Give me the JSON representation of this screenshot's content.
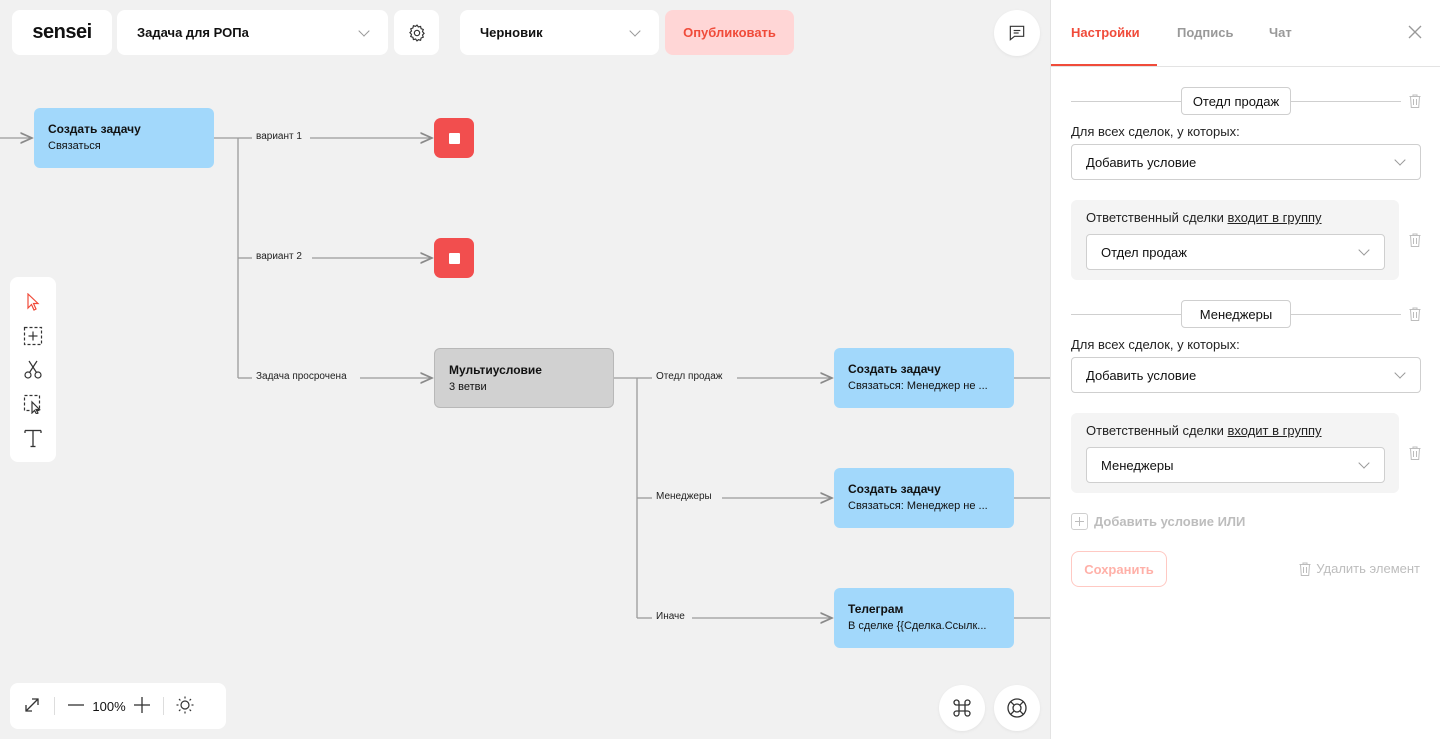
{
  "header": {
    "logo": "sensei",
    "process_name": "Задача для РОПа",
    "status": "Черновик",
    "publish_label": "Опубликовать"
  },
  "canvas": {
    "nodes": {
      "create_task_1": {
        "title": "Создать задачу",
        "subtitle": "Связаться"
      },
      "multi": {
        "title": "Мультиусловие",
        "subtitle": "3 ветви"
      },
      "create_task_2": {
        "title": "Создать задачу",
        "subtitle": "Связаться: Менеджер не ..."
      },
      "create_task_3": {
        "title": "Создать задачу",
        "subtitle": "Связаться: Менеджер не ..."
      },
      "telegram": {
        "title": "Телеграм",
        "subtitle": "В сделке {{Сделка.Ссылк..."
      }
    },
    "edge_labels": {
      "v1": "вариант 1",
      "v2": "вариант 2",
      "overdue": "Задача просрочена",
      "sales": "Отедл продаж",
      "managers": "Менеджеры",
      "else": "Иначе"
    },
    "zoom": "100%"
  },
  "panel": {
    "tabs": [
      "Настройки",
      "Подпись",
      "Чат"
    ],
    "groups": [
      {
        "name": "Отедл продаж",
        "for_all_label": "Для всех сделок, у которых:",
        "add_condition": "Добавить условие",
        "cond_prefix": "Ответственный сделки",
        "cond_link": "входит в группу",
        "cond_value": "Отдел продаж"
      },
      {
        "name": "Менеджеры",
        "for_all_label": "Для всех сделок, у которых:",
        "add_condition": "Добавить условие",
        "cond_prefix": "Ответственный сделки",
        "cond_link": "входит в группу",
        "cond_value": "Менеджеры"
      }
    ],
    "add_or": "Добавить условие ИЛИ",
    "save": "Сохранить",
    "delete_element": "Удалить элемент"
  },
  "colors": {
    "accent": "#f04b3a",
    "node_blue": "#a2d8fb",
    "node_gray": "#d1d1d1",
    "stop_red": "#f24e4e",
    "publish_bg": "#ffd6d6"
  }
}
